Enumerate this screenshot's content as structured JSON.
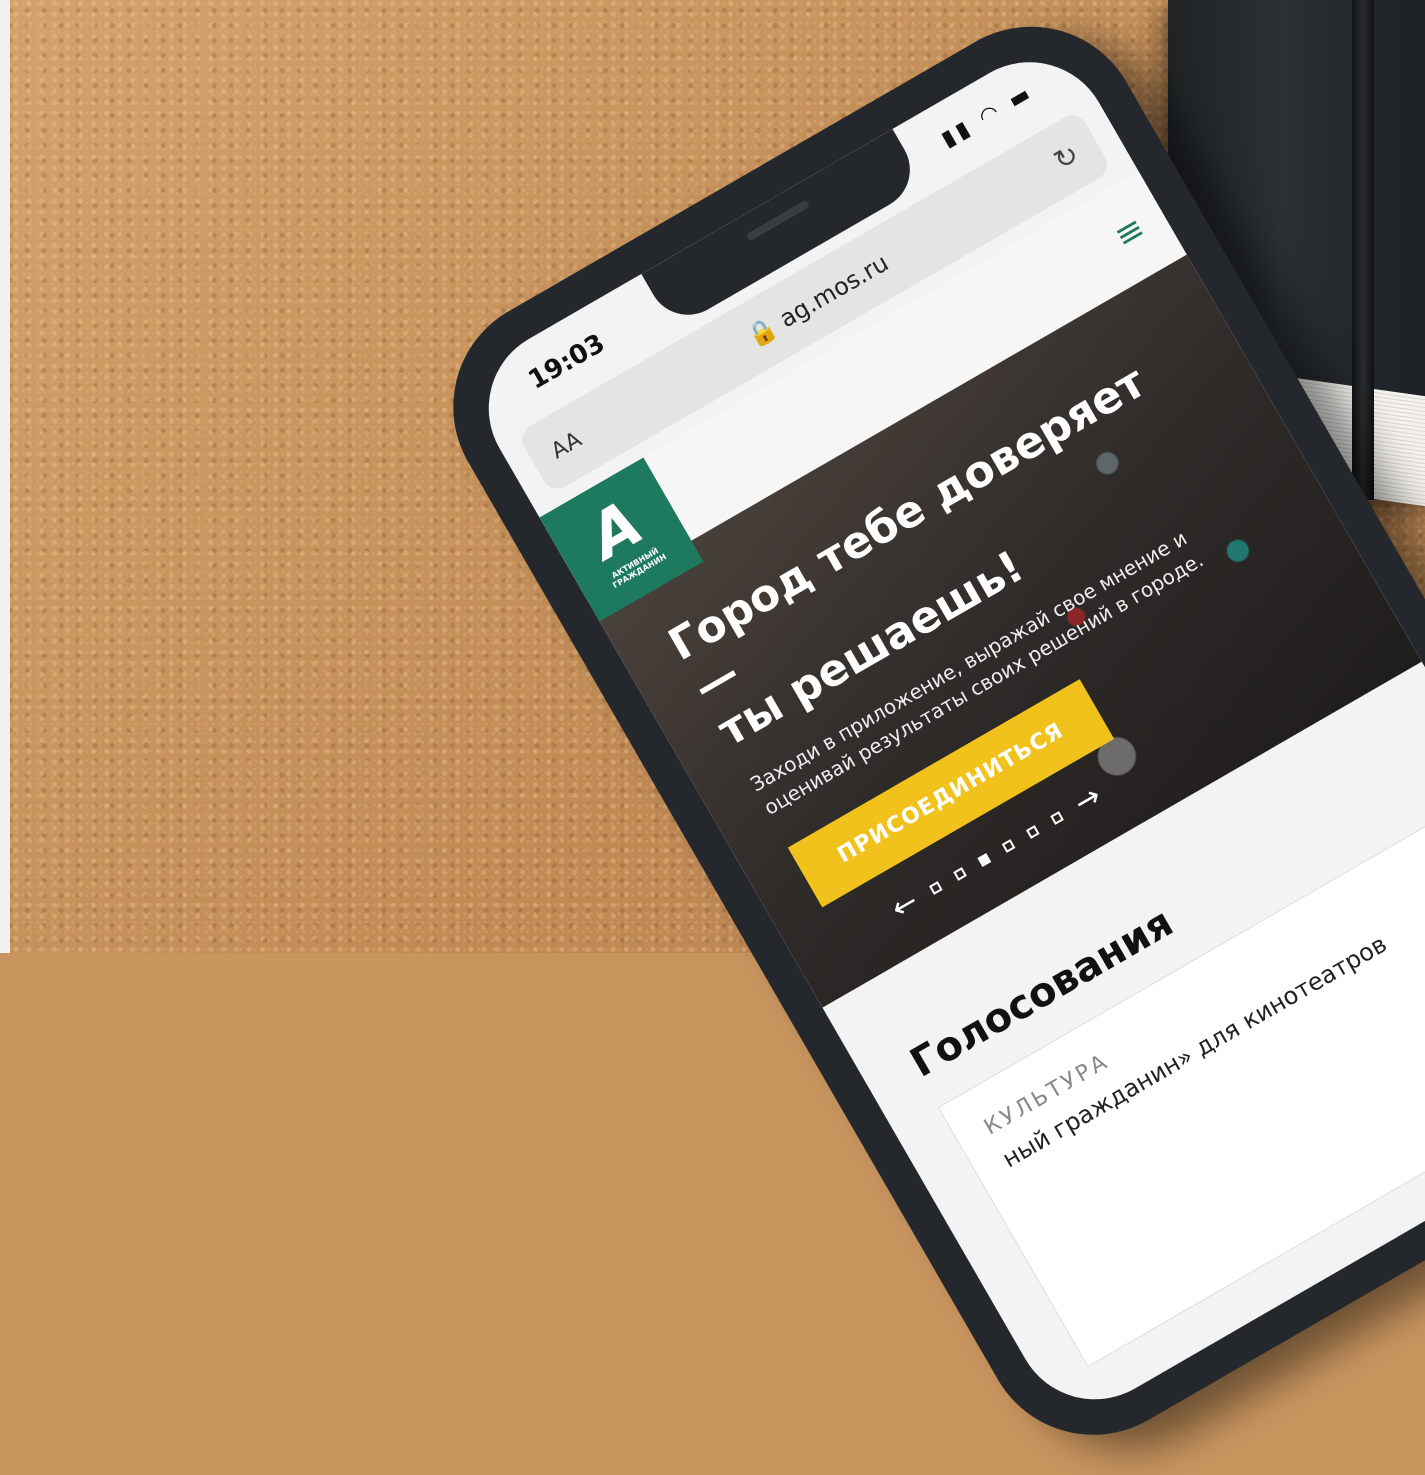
{
  "status": {
    "time": "19:03"
  },
  "browser": {
    "text_size": "AA",
    "url": "ag.mos.ru"
  },
  "hero": {
    "title_line1": "Город тебе доверяет —",
    "title_line2": "ты решаешь!",
    "subtitle_line1": "Заходи в приложение, выражай свое мнение и",
    "subtitle_line2": "оценивай результаты своих решений в городе.",
    "cta": "ПРИСОЕДИНИТЬСЯ"
  },
  "slider": {
    "total": 6,
    "active": 3
  },
  "votes": {
    "title": "Голосования",
    "card_category": "КУЛЬТУРА",
    "card_text": "ный гражданин» для кинотеатров"
  }
}
